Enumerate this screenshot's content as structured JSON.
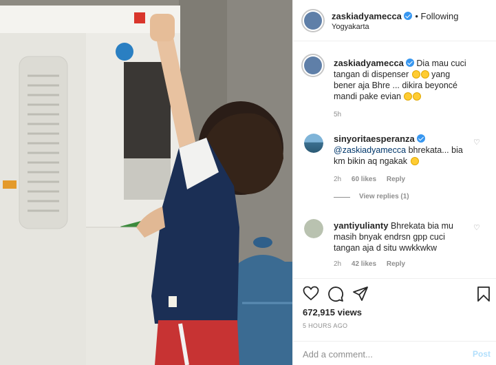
{
  "header": {
    "username": "zaskiadyamecca",
    "follow_label": "Following",
    "location": "Yogyakarta"
  },
  "caption": {
    "username": "zaskiadyamecca",
    "text": "Dia mau cuci tangan di dispenser 😞😞 yang bener aja Bhre ... dikira beyoncé mandi pake evian 😂😂",
    "line1": "Dia mau cuci",
    "line2a": "tangan di dispenser",
    "line2b": "yang",
    "line3": "bener aja Bhre ... dikira beyoncé",
    "line4": "mandi pake evian",
    "time": "5h"
  },
  "comments": [
    {
      "username": "sinyoritaesperanza",
      "mention": "@zaskiadyamecca",
      "line1": "bhrekata... bia",
      "line2": "km bikin aq ngakak",
      "time": "2h",
      "likes": "60 likes",
      "reply": "Reply",
      "view_replies": "View replies (1)"
    },
    {
      "username": "yantiyulianty",
      "line1": "Bhrekata bia mu",
      "line2": "masih bnyak endrsn gpp cuci",
      "line3": "tangan aja d situ wwkkwkw",
      "time": "2h",
      "likes": "42 likes",
      "reply": "Reply"
    }
  ],
  "stats": {
    "views": "672,915 views",
    "ago": "5 HOURS AGO"
  },
  "composer": {
    "placeholder": "Add a comment...",
    "post_label": "Post"
  },
  "icons": {
    "like": "heart-icon",
    "comment": "comment-icon",
    "share": "share-icon",
    "save": "bookmark-icon",
    "verified": "verified-badge-icon",
    "emoji_sad": "disappointed-face",
    "emoji_laugh": "grinning-sweat-face"
  },
  "colors": {
    "verified": "#3897f0",
    "post_disabled": "#b2dffc",
    "meta": "#8e8e8e",
    "text": "#262626"
  }
}
